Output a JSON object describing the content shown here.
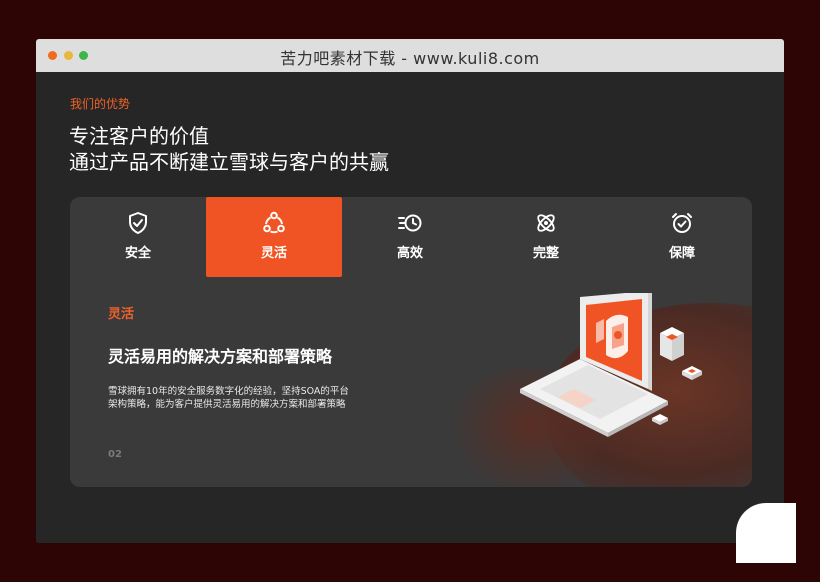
{
  "window": {
    "title": "苦力吧素材下载 - www.kuli8.com"
  },
  "section": {
    "eyebrow": "我们的优势",
    "heading_line1": "专注客户的价值",
    "heading_line2": "通过产品不断建立雪球与客户的共赢"
  },
  "tabs": [
    {
      "label": "安全",
      "icon": "shield-check-icon",
      "active": false
    },
    {
      "label": "灵活",
      "icon": "nodes-cycle-icon",
      "active": true
    },
    {
      "label": "高效",
      "icon": "clock-lines-icon",
      "active": false
    },
    {
      "label": "完整",
      "icon": "atom-icon",
      "active": false
    },
    {
      "label": "保障",
      "icon": "alarm-check-icon",
      "active": false
    }
  ],
  "feature": {
    "label": "灵活",
    "title": "灵活易用的解决方案和部署策略",
    "description": "雪球拥有10年的安全服务数字化的经验，坚持SOA的平台架构策略，能为客户提供灵活易用的解决方案和部署策略",
    "index": "02"
  },
  "colors": {
    "accent": "#f05424",
    "background": "#262626",
    "card": "#3a3a3a"
  }
}
